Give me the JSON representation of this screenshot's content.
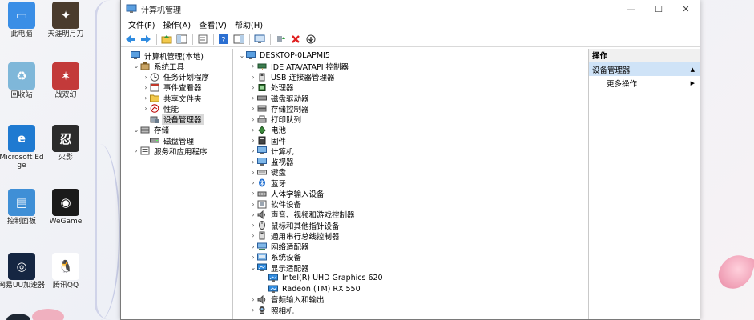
{
  "desktop": {
    "icons": [
      {
        "label": "此电脑",
        "color": "#3a8ee6",
        "glyph": "▭"
      },
      {
        "label": "天涯明月刀",
        "color": "#4a3b2d",
        "glyph": "✦"
      },
      {
        "label": "回收站",
        "color": "#7fb7d9",
        "glyph": "♻"
      },
      {
        "label": "战双幻",
        "color": "#c33a3a",
        "glyph": "✶"
      },
      {
        "label": "Microsoft Edge",
        "color": "#1f7ad1",
        "glyph": "e"
      },
      {
        "label": "火影",
        "color": "#2b2b2b",
        "glyph": "忍"
      },
      {
        "label": "控制面板",
        "color": "#3f8fd6",
        "glyph": "▤"
      },
      {
        "label": "WeGame",
        "color": "#1a1a1a",
        "glyph": "◉"
      },
      {
        "label": "网易UU加速器",
        "color": "#152642",
        "glyph": "◎"
      },
      {
        "label": "腾讯QQ",
        "color": "#ffffff",
        "glyph": "🐧"
      }
    ]
  },
  "window": {
    "title": "计算机管理",
    "controls": {
      "minimize": "—",
      "maximize": "☐",
      "close": "✕"
    },
    "menu": [
      "文件(F)",
      "操作(A)",
      "查看(V)",
      "帮助(H)"
    ],
    "left_tree": [
      {
        "label": "计算机管理(本地)",
        "level": 0,
        "exp": "",
        "icon": "computer"
      },
      {
        "label": "系统工具",
        "level": 1,
        "exp": "⌄",
        "icon": "tools"
      },
      {
        "label": "任务计划程序",
        "level": 2,
        "exp": "›",
        "icon": "clock"
      },
      {
        "label": "事件查看器",
        "level": 2,
        "exp": "›",
        "icon": "event"
      },
      {
        "label": "共享文件夹",
        "level": 2,
        "exp": "›",
        "icon": "folder"
      },
      {
        "label": "性能",
        "level": 2,
        "exp": "›",
        "icon": "perf"
      },
      {
        "label": "设备管理器",
        "level": 2,
        "exp": "",
        "icon": "devmgr",
        "selected": true
      },
      {
        "label": "存储",
        "level": 1,
        "exp": "⌄",
        "icon": "storage"
      },
      {
        "label": "磁盘管理",
        "level": 2,
        "exp": "",
        "icon": "disk"
      },
      {
        "label": "服务和应用程序",
        "level": 1,
        "exp": "›",
        "icon": "services"
      }
    ],
    "device_tree": [
      {
        "label": "DESKTOP-0LAPMI5",
        "level": 0,
        "exp": "⌄",
        "icon": "computer"
      },
      {
        "label": "IDE ATA/ATAPI 控制器",
        "level": 1,
        "exp": "›",
        "icon": "ide"
      },
      {
        "label": "USB 连接器管理器",
        "level": 1,
        "exp": "›",
        "icon": "usb"
      },
      {
        "label": "处理器",
        "level": 1,
        "exp": "›",
        "icon": "cpu"
      },
      {
        "label": "磁盘驱动器",
        "level": 1,
        "exp": "›",
        "icon": "disk"
      },
      {
        "label": "存储控制器",
        "level": 1,
        "exp": "›",
        "icon": "storage"
      },
      {
        "label": "打印队列",
        "level": 1,
        "exp": "›",
        "icon": "printer"
      },
      {
        "label": "电池",
        "level": 1,
        "exp": "›",
        "icon": "battery"
      },
      {
        "label": "固件",
        "level": 1,
        "exp": "›",
        "icon": "firmware"
      },
      {
        "label": "计算机",
        "level": 1,
        "exp": "›",
        "icon": "monitor"
      },
      {
        "label": "监视器",
        "level": 1,
        "exp": "›",
        "icon": "monitor"
      },
      {
        "label": "键盘",
        "level": 1,
        "exp": "›",
        "icon": "keyboard"
      },
      {
        "label": "蓝牙",
        "level": 1,
        "exp": "›",
        "icon": "bluetooth"
      },
      {
        "label": "人体学输入设备",
        "level": 1,
        "exp": "›",
        "icon": "hid"
      },
      {
        "label": "软件设备",
        "level": 1,
        "exp": "›",
        "icon": "software"
      },
      {
        "label": "声音、视频和游戏控制器",
        "level": 1,
        "exp": "›",
        "icon": "sound"
      },
      {
        "label": "鼠标和其他指针设备",
        "level": 1,
        "exp": "›",
        "icon": "mouse"
      },
      {
        "label": "通用串行总线控制器",
        "level": 1,
        "exp": "›",
        "icon": "usb"
      },
      {
        "label": "网络适配器",
        "level": 1,
        "exp": "›",
        "icon": "network"
      },
      {
        "label": "系统设备",
        "level": 1,
        "exp": "›",
        "icon": "system"
      },
      {
        "label": "显示适配器",
        "level": 1,
        "exp": "⌄",
        "icon": "display"
      },
      {
        "label": "Intel(R) UHD Graphics 620",
        "level": 2,
        "exp": "",
        "icon": "display"
      },
      {
        "label": "Radeon (TM) RX 550",
        "level": 2,
        "exp": "",
        "icon": "display"
      },
      {
        "label": "音频输入和输出",
        "level": 1,
        "exp": "›",
        "icon": "audio"
      },
      {
        "label": "照相机",
        "level": 1,
        "exp": "›",
        "icon": "camera"
      }
    ],
    "actions": {
      "header": "操作",
      "section": "设备管理器",
      "section_arrow": "▲",
      "more": "更多操作",
      "more_arrow": "▶"
    }
  }
}
